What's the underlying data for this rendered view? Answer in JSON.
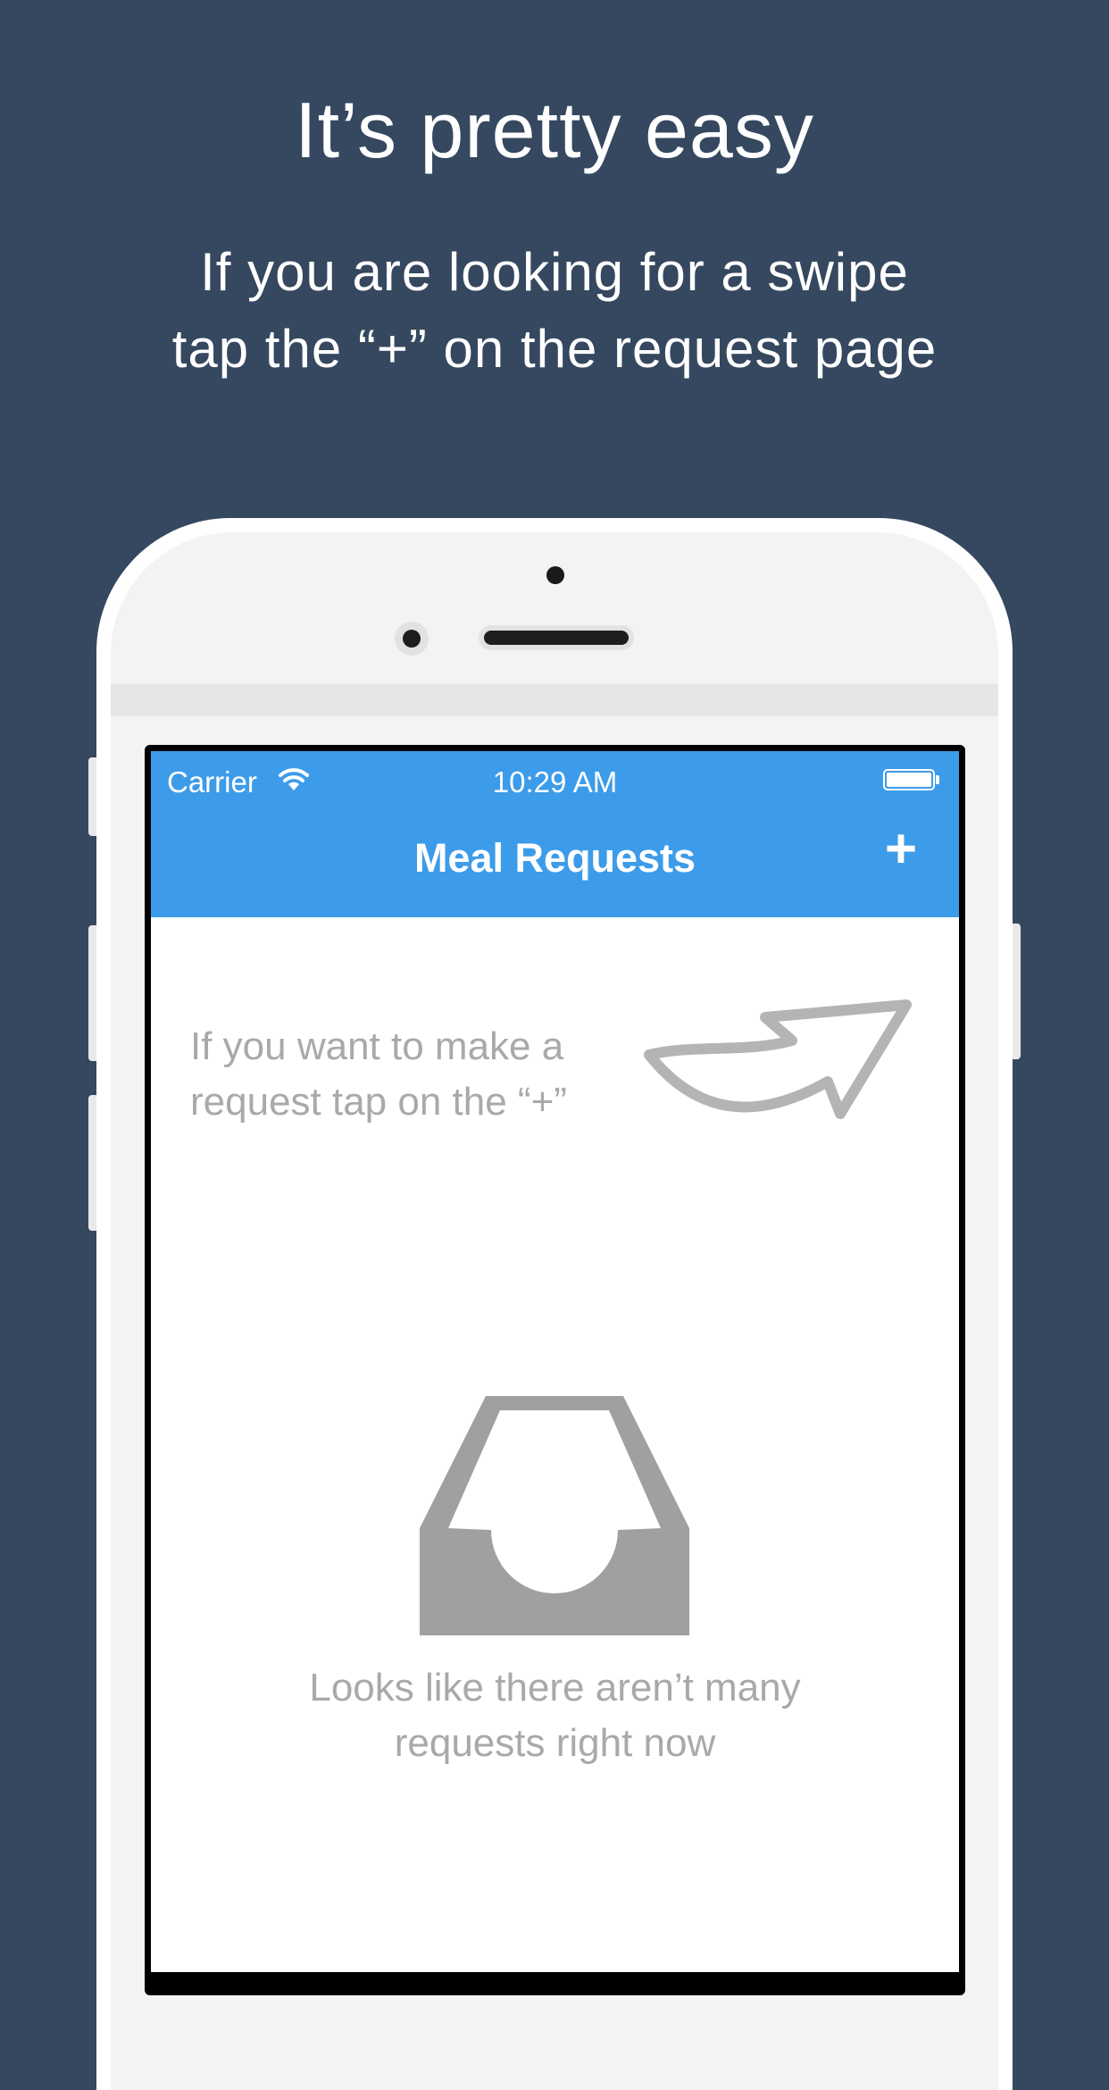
{
  "promo": {
    "headline": "It’s pretty easy",
    "subline_line1": "If you are looking for a swipe",
    "subline_line2": "tap the “+” on the request page"
  },
  "status_bar": {
    "carrier": "Carrier",
    "time": "10:29 AM",
    "icons": [
      "wifi-icon",
      "battery-icon"
    ]
  },
  "navbar": {
    "title": "Meal Requests",
    "add_label": "+"
  },
  "content": {
    "hint_line1": "If you want to make a",
    "hint_line2": "request tap on the “+”",
    "hint_icon": "curved-arrow-icon",
    "empty_icon": "inbox-tray-icon",
    "empty_line1": "Looks like there aren’t many",
    "empty_line2": "requests right now"
  },
  "colors": {
    "background": "#35485f",
    "navbar": "#3d9ce9",
    "muted_text": "#a9a9a9",
    "icon_gray": "#a0a0a0"
  }
}
